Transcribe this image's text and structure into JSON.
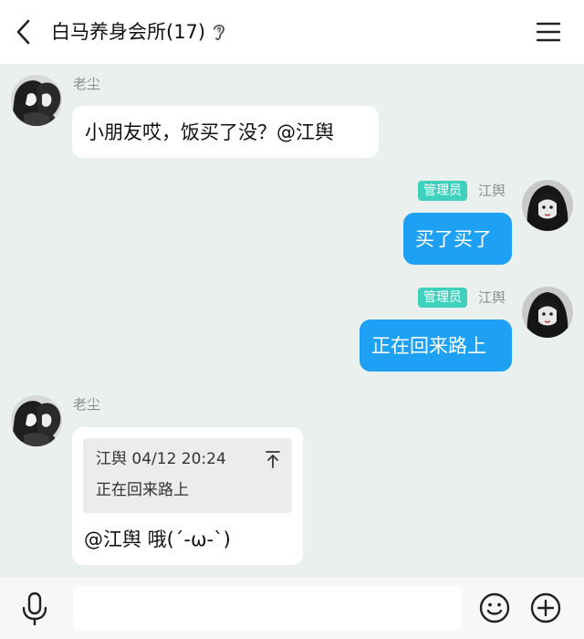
{
  "header": {
    "title": "白马养身会所(17)",
    "back_icon": "chevron-left-icon",
    "ear_icon": "ear-icon",
    "menu_icon": "hamburger-menu-icon"
  },
  "messages": [
    {
      "side": "left",
      "sender": "老尘",
      "text": "小朋友哎，饭买了没？@江舆"
    },
    {
      "side": "right",
      "sender": "江舆",
      "badge": "管理员",
      "text": "买了买了"
    },
    {
      "side": "right",
      "sender": "江舆",
      "badge": "管理员",
      "text": "正在回来路上"
    },
    {
      "side": "left",
      "sender": "老尘",
      "quote": {
        "meta": "江舆 04/12 20:24",
        "text": "正在回来路上"
      },
      "text": "@江舆 哦(´-ω-`)"
    }
  ],
  "input": {
    "placeholder": "",
    "value": ""
  },
  "toolbar": {
    "mic_icon": "microphone-icon",
    "emoji_icon": "smiley-icon",
    "plus_icon": "plus-circle-icon"
  },
  "colors": {
    "accent": "#1ea0f5",
    "badge": "#3fd1bd",
    "chat_bg": "#eaf0ee"
  }
}
